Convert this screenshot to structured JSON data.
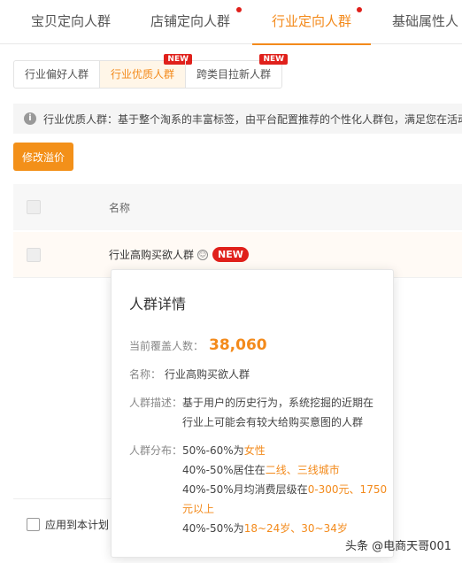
{
  "top_tabs": [
    {
      "label": "宝贝定向人群"
    },
    {
      "label": "店铺定向人群"
    },
    {
      "label": "行业定向人群"
    },
    {
      "label": "基础属性人"
    }
  ],
  "sub_tabs": [
    {
      "label": "行业偏好人群"
    },
    {
      "label": "行业优质人群",
      "badge": "NEW"
    },
    {
      "label": "跨类目拉新人群",
      "badge": "NEW"
    }
  ],
  "info": {
    "text": "行业优质人群：基于整个淘系的丰富标签，由平台配置推荐的个性化人群包，满足您在活动"
  },
  "toolbar": {
    "edit_label": "修改溢价"
  },
  "table": {
    "col_name": "名称",
    "rows": [
      {
        "name": "行业高购买欲人群",
        "badge": "NEW"
      }
    ]
  },
  "popup": {
    "title": "人群详情",
    "coverage_label": "当前覆盖人数：",
    "coverage_value": "38,060",
    "name_label": "名称：",
    "name_value": "行业高购买欲人群",
    "desc_label": "人群描述：",
    "desc_line1": "基于用户的历史行为，系统挖掘的近期在",
    "desc_line2": "行业上可能会有较大给购买意图的人群",
    "dist_label": "人群分布：",
    "dist": [
      {
        "pre": "50%-60%为",
        "hl": "女性",
        "post": ""
      },
      {
        "pre": "40%-50%居住在",
        "hl": "二线、三线城市",
        "post": ""
      },
      {
        "pre": "40%-50%月均消费层级在",
        "hl": "0-300元、1750",
        "post": ""
      },
      {
        "pre": "",
        "hl": "元以上",
        "post": ""
      },
      {
        "pre": "40%-50%为",
        "hl": "18~24岁、30~34岁",
        "post": ""
      }
    ]
  },
  "footer": {
    "apply_label": "应用到本计划"
  },
  "watermark": "头条 @电商天哥001",
  "colors": {
    "accent": "#f38a1b",
    "badge_red": "#e0201b"
  }
}
